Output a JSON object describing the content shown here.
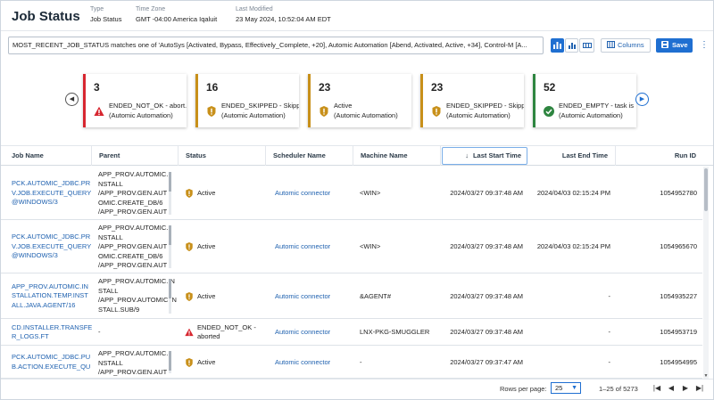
{
  "header": {
    "title": "Job Status",
    "meta": [
      {
        "key": "Type",
        "value": "Job Status"
      },
      {
        "key": "Time Zone",
        "value": "GMT -04:00 America Iqaluit"
      },
      {
        "key": "Last Modified",
        "value": "23 May 2024, 10:52:04 AM EDT"
      }
    ]
  },
  "toolbar": {
    "filter_text": "MOST_RECENT_JOB_STATUS matches one of  'AutoSys [Activated, Bypass, Effectively_Complete,  +20], Automic Automation [Abend, Activated, Active,  +34], Control-M [A...",
    "columns_label": "Columns",
    "save_label": "Save"
  },
  "cards": [
    {
      "count": "3",
      "label": "ENDED_NOT_OK - abort...",
      "sub": "(Automic Automation)",
      "status": "error",
      "color": "#d7262f"
    },
    {
      "count": "16",
      "label": "ENDED_SKIPPED - Skipp...",
      "sub": "(Automic Automation)",
      "status": "warning",
      "color": "#c8901a"
    },
    {
      "count": "23",
      "label": "Active",
      "sub": "(Automic Automation)",
      "status": "warning",
      "color": "#c8901a"
    },
    {
      "count": "23",
      "label": "ENDED_SKIPPED - Skipp...",
      "sub": "(Automic Automation)",
      "status": "warning",
      "color": "#c8901a"
    },
    {
      "count": "52",
      "label": "ENDED_EMPTY - task is",
      "sub": "(Automic Automation)",
      "status": "success",
      "color": "#2e8540"
    }
  ],
  "table": {
    "columns": [
      "Job Name",
      "Parent",
      "Status",
      "Scheduler Name",
      "Machine Name",
      "Last Start Time",
      "Last End Time",
      "Run ID"
    ],
    "sort_indicator": "↓",
    "rows": [
      {
        "job": [
          "PCK.AUTOMIC_JDBC.PR",
          "V.JOB.EXECUTE_QUERY",
          "@WINDOWS/3"
        ],
        "parent": [
          "APP_PROV.AUTOMIC.I",
          "NSTALL",
          "/APP_PROV.GEN.AUT",
          "OMIC.CREATE_DB/6",
          "/APP_PROV.GEN.AUT"
        ],
        "status": [
          "Active"
        ],
        "status_type": "warning",
        "scheduler": "Automic connector",
        "machine": "<WIN>",
        "start": "2024/03/27 09:37:48 AM",
        "end": "2024/04/03 02:15:24 PM",
        "run_id": "1054952780"
      },
      {
        "job": [
          "PCK.AUTOMIC_JDBC.PR",
          "V.JOB.EXECUTE_QUERY",
          "@WINDOWS/3"
        ],
        "parent": [
          "APP_PROV.AUTOMIC.I",
          "NSTALL",
          "/APP_PROV.GEN.AUT",
          "OMIC.CREATE_DB/6",
          "/APP_PROV.GEN.AUT"
        ],
        "status": [
          "Active"
        ],
        "status_type": "warning",
        "scheduler": "Automic connector",
        "machine": "<WIN>",
        "start": "2024/03/27 09:37:48 AM",
        "end": "2024/04/03 02:15:24 PM",
        "run_id": "1054965670"
      },
      {
        "job": [
          "APP_PROV.AUTOMIC.IN",
          "STALLATION.TEMP.INST",
          "ALL.JAVA.AGENT/16"
        ],
        "parent": [
          "APP_PROV.AUTOMIC.IN",
          "STALL",
          "/APP_PROV.AUTOMIC.IN",
          "STALL.SUB/9"
        ],
        "status": [
          "Active"
        ],
        "status_type": "warning",
        "scheduler": "Automic connector",
        "machine": "&AGENT#",
        "start": "2024/03/27 09:37:48 AM",
        "end": "-",
        "run_id": "1054935227"
      },
      {
        "job": [
          "CD.INSTALLER.TRANSFE",
          "R_LOGS.FT"
        ],
        "parent": [
          "-"
        ],
        "status": [
          "ENDED_NOT_OK -",
          "aborted"
        ],
        "status_type": "error",
        "scheduler": "Automic connector",
        "machine": "LNX-PKG-SMUGGLER",
        "start": "2024/03/27 09:37:48 AM",
        "end": "-",
        "run_id": "1054953719"
      },
      {
        "job": [
          "PCK.AUTOMIC_JDBC.PU",
          "B.ACTION.EXECUTE_QU"
        ],
        "parent": [
          "APP_PROV.AUTOMIC.I",
          "NSTALL",
          "/APP_PROV.GEN.AUT"
        ],
        "status": [
          "Active"
        ],
        "status_type": "warning",
        "scheduler": "Automic connector",
        "machine": "-",
        "start": "2024/03/27 09:37:47 AM",
        "end": "-",
        "run_id": "1054954995"
      }
    ]
  },
  "footer": {
    "rows_per_page_label": "Rows per page:",
    "rows_per_page": "25",
    "range": "1–25 of 5273"
  }
}
